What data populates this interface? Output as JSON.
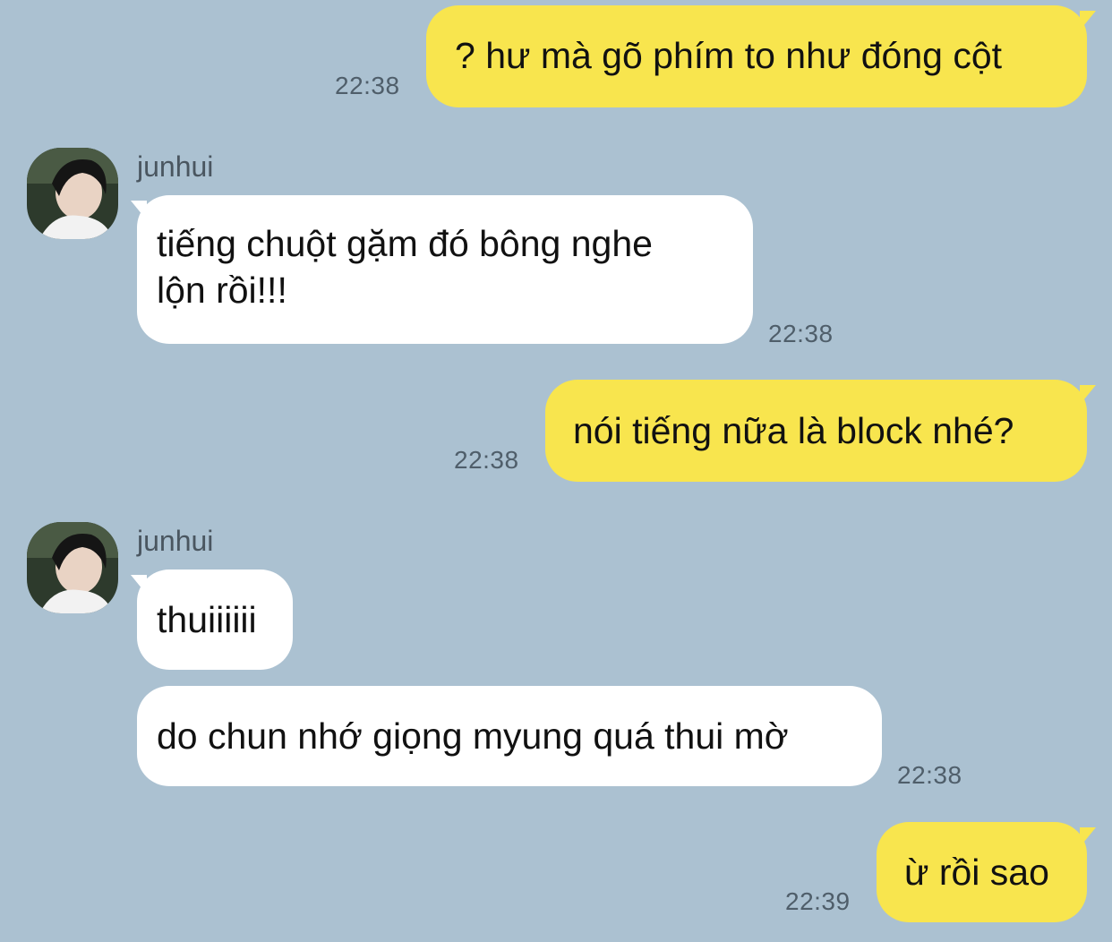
{
  "messages": [
    {
      "text": "? hư mà gõ phím to như đóng cột",
      "time": "22:38"
    },
    {
      "sender": "junhui",
      "text_lines": [
        "tiếng chuột gặm đó bông nghe",
        "lộn rồi!!!"
      ],
      "time": "22:38"
    },
    {
      "text": "nói tiếng nữa là block nhé?",
      "time": "22:38"
    },
    {
      "sender": "junhui",
      "text": "thuiiiiii"
    },
    {
      "text": "do chun nhớ giọng myung quá thui mờ",
      "time": "22:38"
    },
    {
      "text": "ừ rồi sao",
      "time": "22:39"
    }
  ],
  "colors": {
    "background": "#abc1d1",
    "my_bubble": "#f8e54e",
    "their_bubble": "#ffffff",
    "time_text": "#4f5e6a"
  }
}
